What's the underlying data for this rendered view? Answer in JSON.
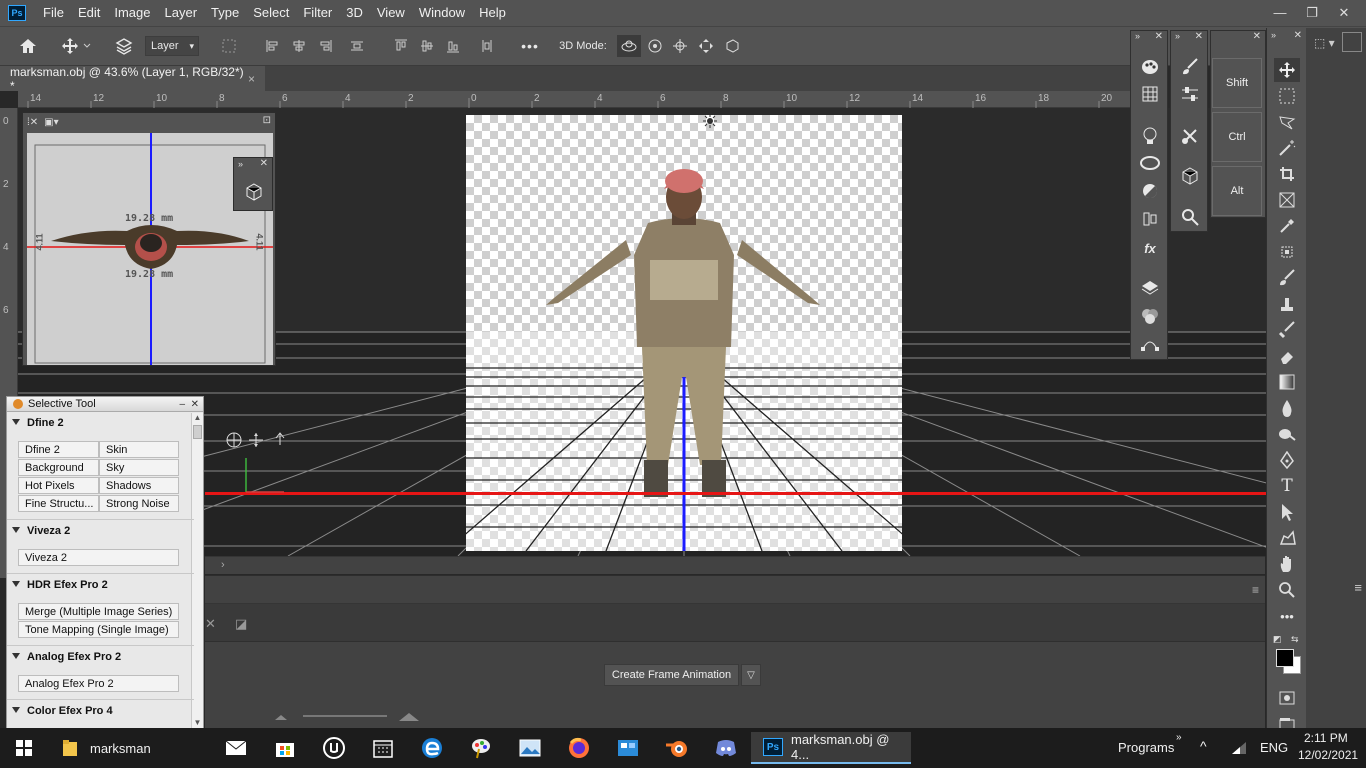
{
  "menu": [
    "File",
    "Edit",
    "Image",
    "Layer",
    "Type",
    "Select",
    "Filter",
    "3D",
    "View",
    "Window",
    "Help"
  ],
  "app_logo": "Ps",
  "window_controls": {
    "minimize": "—",
    "restore": "❐",
    "close": "✕"
  },
  "options": {
    "layer_select": "Layer",
    "mode_label": "3D Mode:",
    "more": "•••"
  },
  "doc_tab": {
    "title": "marksman.obj @ 43.6% (Layer 1, RGB/32*) *",
    "close": "×"
  },
  "ruler_h": [
    "14",
    "12",
    "10",
    "8",
    "6",
    "4",
    "2",
    "0",
    "2",
    "4",
    "6",
    "8",
    "10",
    "12",
    "14",
    "16",
    "18",
    "20"
  ],
  "ruler_v": [
    "0",
    "2",
    "4",
    "6"
  ],
  "nav": {
    "measure": "19.28 mm",
    "measure2": "19.28 mm",
    "side": "4.11",
    "side2": "4.11"
  },
  "selective_tool": {
    "title": "Selective Tool",
    "sections": [
      {
        "name": "Dfine 2",
        "buttons": [
          "Dfine 2",
          "Skin",
          "Background",
          "Sky",
          "Hot Pixels",
          "Shadows",
          "Fine Structu...",
          "Strong Noise"
        ]
      },
      {
        "name": "Viveza 2",
        "buttons": [
          "Viveza 2"
        ]
      },
      {
        "name": "HDR Efex Pro 2",
        "buttons": [
          "Merge (Multiple Image Series)",
          "Tone Mapping (Single Image)"
        ]
      },
      {
        "name": "Analog Efex Pro 2",
        "buttons": [
          "Analog Efex Pro 2"
        ]
      },
      {
        "name": "Color Efex Pro 4",
        "buttons": []
      }
    ]
  },
  "modifier_keys": [
    "Shift",
    "Ctrl",
    "Alt"
  ],
  "timeline": {
    "create_button": "Create Frame Animation"
  },
  "taskbar": {
    "folder_label": "marksman",
    "ps_label": "marksman.obj @ 4...",
    "programs": "Programs",
    "lang": "ENG",
    "time": "2:11 PM",
    "date": "12/02/2021"
  },
  "icons": [
    "home-icon",
    "move-icon",
    "search-icon",
    "settings-icon"
  ]
}
